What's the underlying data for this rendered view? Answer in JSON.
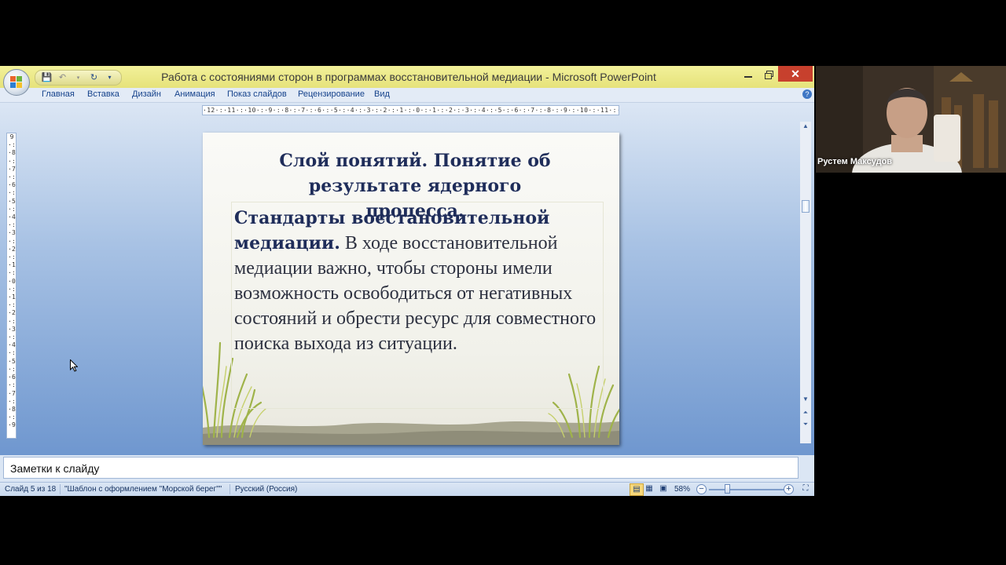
{
  "window": {
    "title": "Работа с состояниями сторон в программах восстановительной медиации",
    "app_title": "Microsoft PowerPoint",
    "title_separator": " - "
  },
  "ribbon": {
    "tabs": [
      {
        "label": "Главная"
      },
      {
        "label": "Вставка"
      },
      {
        "label": "Дизайн"
      },
      {
        "label": "Анимация"
      },
      {
        "label": "Показ слайдов"
      },
      {
        "label": "Рецензирование"
      },
      {
        "label": "Вид"
      }
    ]
  },
  "rulers": {
    "horizontal": "·12·:·11·:·10·:·9·:·8·:·7·:·6·:·5·:·4·:·3·:·2·:·1·:·0·:·1·:·2·:·3·:·4·:·5·:·6·:·7·:·8·:·9·:·10·:·11·:·12·",
    "vertical": "9·:·8·:·7·:·6·:·5·:·4·:·3·:·2·:·1·:·0·:·1·:·2·:·3·:·4·:·5·:·6·:·7·:·8·:·9"
  },
  "slide": {
    "title_lines": [
      "Слой понятий. Понятие об",
      "результате ядерного процесса."
    ],
    "body_bold": "Стандарты восстановительной медиации.",
    "body_text": " В ходе восстановительной медиации важно, чтобы стороны имели возможность освободиться от негативных состояний и обрести ресурс для совместного поиска выхода из ситуации."
  },
  "notes": {
    "placeholder": "Заметки к слайду"
  },
  "status": {
    "slide_counter": "Слайд 5 из 18",
    "theme": "\"Шаблон с оформлением \"Морской берег\"\"",
    "language": "Русский (Россия)",
    "zoom": "58%",
    "zoom_value": 58
  },
  "webcam": {
    "participant_name": "Рустем Максудов"
  },
  "colors": {
    "title_bar": "#e6e27a",
    "ribbon_tab_text": "#15428b",
    "slide_title": "#1f2d5a",
    "close_button": "#c7402d"
  }
}
